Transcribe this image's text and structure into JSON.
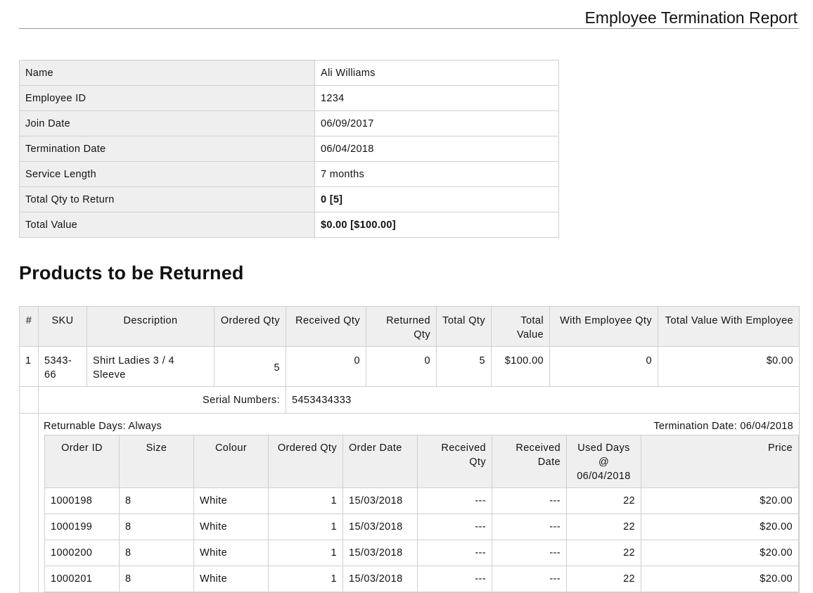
{
  "report": {
    "title": "Employee Termination Report"
  },
  "summary": [
    {
      "label": "Name",
      "value": "Ali Williams",
      "bold": false
    },
    {
      "label": "Employee ID",
      "value": "1234",
      "bold": false
    },
    {
      "label": "Join Date",
      "value": "06/09/2017",
      "bold": false
    },
    {
      "label": "Termination Date",
      "value": "06/04/2018",
      "bold": false
    },
    {
      "label": "Service Length",
      "value": "7 months",
      "bold": false
    },
    {
      "label": "Total Qty to Return",
      "value": "0 [5]",
      "bold": true
    },
    {
      "label": "Total Value",
      "value": "$0.00 [$100.00]",
      "bold": true
    }
  ],
  "products": {
    "section_title": "Products to be Returned",
    "headers": {
      "num": "#",
      "sku": "SKU",
      "description": "Description",
      "ordered_qty": "Ordered Qty",
      "received_qty": "Received Qty",
      "returned_qty": "Returned Qty",
      "total_qty": "Total Qty",
      "total_value": "Total Value",
      "with_employee_qty": "With Employee Qty",
      "total_value_with_employee": "Total Value With Employee"
    },
    "rows": [
      {
        "num": "1",
        "sku": "5343-66",
        "description": "Shirt Ladies 3 / 4 Sleeve",
        "ordered_qty": "5",
        "received_qty": "0",
        "returned_qty": "0",
        "total_qty": "5",
        "total_value": "$100.00",
        "with_employee_qty": "0",
        "total_value_with_employee": "$0.00",
        "serial_label": "Serial Numbers:",
        "serial_value": "5453434333",
        "returnable_days": "Returnable Days: Always",
        "termination_date": "Termination Date: 06/04/2018"
      }
    ]
  },
  "orders": {
    "headers": {
      "order_id": "Order ID",
      "size": "Size",
      "colour": "Colour",
      "ordered_qty": "Ordered Qty",
      "order_date": "Order Date",
      "received_qty": "Received Qty",
      "received_date": "Received Date",
      "used_days": "Used Days @ 06/04/2018",
      "price": "Price"
    },
    "rows": [
      {
        "order_id": "1000198",
        "size": "8",
        "colour": "White",
        "ordered_qty": "1",
        "order_date": "15/03/2018",
        "received_qty": "---",
        "received_date": "---",
        "used_days": "22",
        "price": "$20.00"
      },
      {
        "order_id": "1000199",
        "size": "8",
        "colour": "White",
        "ordered_qty": "1",
        "order_date": "15/03/2018",
        "received_qty": "---",
        "received_date": "---",
        "used_days": "22",
        "price": "$20.00"
      },
      {
        "order_id": "1000200",
        "size": "8",
        "colour": "White",
        "ordered_qty": "1",
        "order_date": "15/03/2018",
        "received_qty": "---",
        "received_date": "---",
        "used_days": "22",
        "price": "$20.00"
      },
      {
        "order_id": "1000201",
        "size": "8",
        "colour": "White",
        "ordered_qty": "1",
        "order_date": "15/03/2018",
        "received_qty": "---",
        "received_date": "---",
        "used_days": "22",
        "price": "$20.00"
      }
    ]
  }
}
